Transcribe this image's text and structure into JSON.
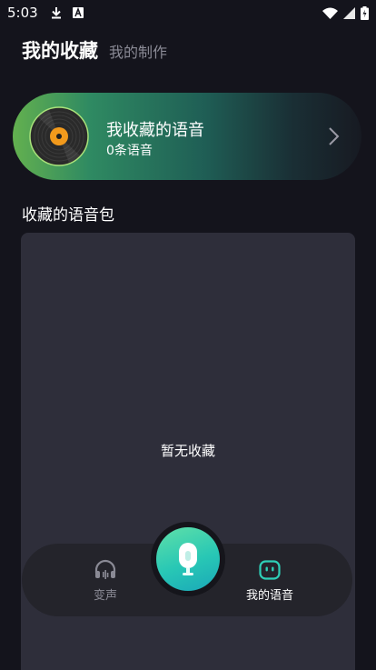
{
  "status_bar": {
    "time": "5:03",
    "left_icons": [
      "download-icon",
      "app-notification-icon"
    ],
    "right_icons": [
      "wifi-icon",
      "signal-icon",
      "battery-icon"
    ]
  },
  "tabs": {
    "active": "我的收藏",
    "inactive": "我的制作"
  },
  "favorite_card": {
    "title": "我收藏的语音",
    "count": "0条语音"
  },
  "section_title": "收藏的语音包",
  "empty_state": "暂无收藏",
  "bottom_nav": {
    "items": [
      {
        "label": "变声",
        "icon": "headphones-icon",
        "active": false
      },
      {
        "label": "我的语音",
        "icon": "robot-face-icon",
        "active": true
      }
    ],
    "center_button_icon": "microphone-icon"
  },
  "colors": {
    "background": "#14141c",
    "accent": "#2ecfb7",
    "panel": "#2e2e3a"
  }
}
